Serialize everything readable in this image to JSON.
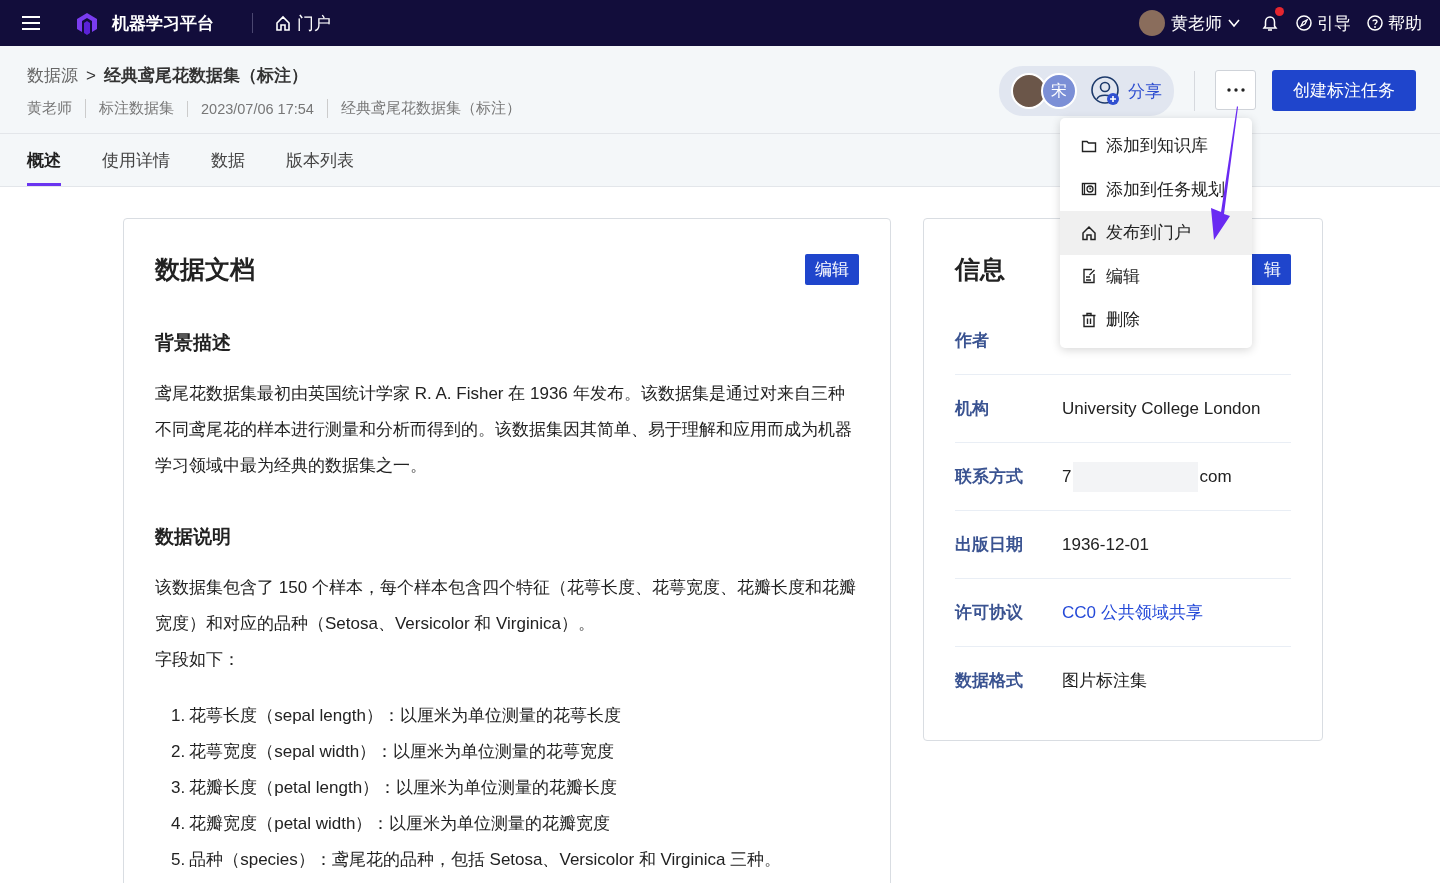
{
  "topbar": {
    "app_name": "机器学习平台",
    "nav_link": "门户",
    "user": "黄老师",
    "notification_unread": true,
    "guide": "引导",
    "help": "帮助"
  },
  "breadcrumb": {
    "parent": "数据源",
    "separator": ">",
    "current": "经典鸢尾花数据集（标注）"
  },
  "meta": [
    "黄老师",
    "标注数据集",
    "2023/07/06 17:54",
    "经典鸢尾花数据集（标注）"
  ],
  "collaborators": [
    {
      "kind": "photo"
    },
    {
      "kind": "initial",
      "initial": "宋"
    }
  ],
  "share_label": "分享",
  "create_button": "创建标注任务",
  "tabs": [
    {
      "label": "概述",
      "selected": true
    },
    {
      "label": "使用详情",
      "selected": false
    },
    {
      "label": "数据",
      "selected": false
    },
    {
      "label": "版本列表",
      "selected": false
    }
  ],
  "menu": {
    "items": [
      {
        "kind": "folder",
        "label": "添加到知识库",
        "highlighted": false
      },
      {
        "kind": "plan",
        "label": "添加到任务规划",
        "highlighted": false
      },
      {
        "kind": "home",
        "label": "发布到门户",
        "highlighted": true
      },
      {
        "kind": "edit",
        "label": "编辑",
        "highlighted": false
      },
      {
        "kind": "trash",
        "label": "删除",
        "highlighted": false
      }
    ]
  },
  "doc": {
    "title": "数据文档",
    "edit": "编辑",
    "sections": [
      {
        "heading": "背景描述",
        "paragraphs": [
          "鸢尾花数据集最初由英国统计学家 R. A. Fisher 在 1936 年发布。该数据集是通过对来自三种不同鸢尾花的样本进行测量和分析而得到的。该数据集因其简单、易于理解和应用而成为机器学习领域中最为经典的数据集之一。"
        ]
      },
      {
        "heading": "数据说明",
        "paragraphs": [
          "该数据集包含了 150 个样本，每个样本包含四个特征（花萼长度、花萼宽度、花瓣长度和花瓣宽度）和对应的品种（Setosa、Versicolor 和 Virginica）。",
          "字段如下："
        ],
        "list": [
          {
            "number": "1.",
            "text": "花萼长度（sepal length）：以厘米为单位测量的花萼长度"
          },
          {
            "number": "2.",
            "text": "花萼宽度（sepal width）：以厘米为单位测量的花萼宽度"
          },
          {
            "number": "3.",
            "text": "花瓣长度（petal length）：以厘米为单位测量的花瓣长度"
          },
          {
            "number": "4.",
            "text": "花瓣宽度（petal width）：以厘米为单位测量的花瓣宽度"
          },
          {
            "number": "5.",
            "text": "品种（species）：鸢尾花的品种，包括 Setosa、Versicolor 和 Virginica 三种。"
          }
        ]
      }
    ]
  },
  "info": {
    "title": "信息",
    "edit": "辑",
    "rows": [
      {
        "label": "作者",
        "kind": "hidden"
      },
      {
        "label": "机构",
        "kind": "text",
        "value": "University College London"
      },
      {
        "label": "联系方式",
        "kind": "redacted",
        "value_start": "7",
        "value_end": "com"
      },
      {
        "label": "出版日期",
        "kind": "text",
        "value": "1936-12-01"
      },
      {
        "label": "许可协议",
        "kind": "link",
        "value": "CC0 公共领域共享"
      },
      {
        "label": "数据格式",
        "kind": "text",
        "value": "图片标注集"
      }
    ]
  }
}
